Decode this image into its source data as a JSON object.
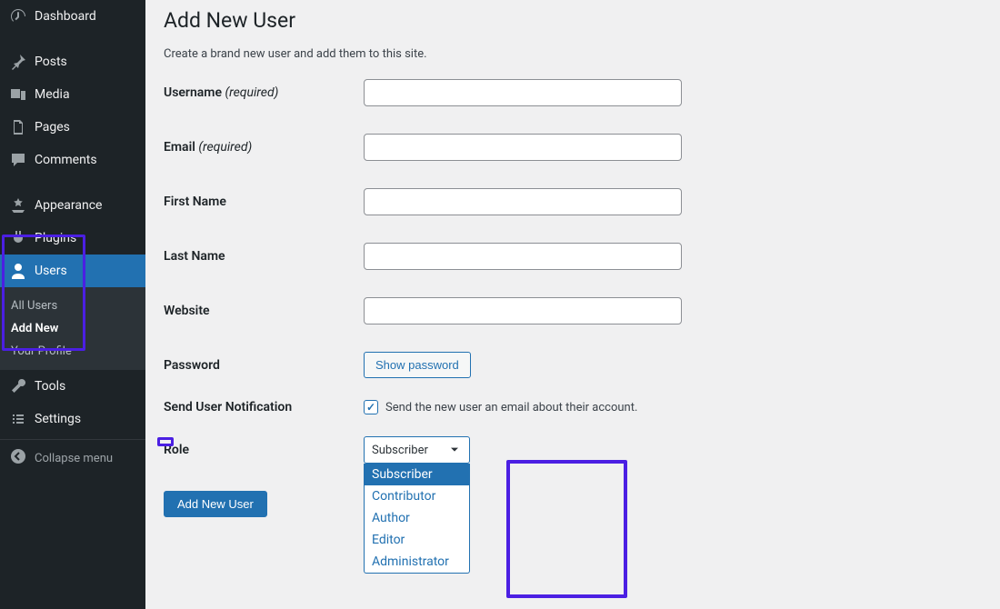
{
  "sidebar": {
    "items": [
      {
        "label": "Dashboard",
        "icon": "dashboard"
      },
      {
        "label": "Posts",
        "icon": "pin"
      },
      {
        "label": "Media",
        "icon": "media"
      },
      {
        "label": "Pages",
        "icon": "pages"
      },
      {
        "label": "Comments",
        "icon": "comments"
      },
      {
        "label": "Appearance",
        "icon": "appearance"
      },
      {
        "label": "Plugins",
        "icon": "plugins"
      },
      {
        "label": "Users",
        "icon": "users",
        "active": true
      },
      {
        "label": "Tools",
        "icon": "tools"
      },
      {
        "label": "Settings",
        "icon": "settings"
      }
    ],
    "submenu": {
      "items": [
        {
          "label": "All Users"
        },
        {
          "label": "Add New",
          "current": true
        },
        {
          "label": "Your Profile"
        }
      ]
    },
    "collapse_label": "Collapse menu"
  },
  "page": {
    "title": "Add New User",
    "description": "Create a brand new user and add them to this site."
  },
  "form": {
    "username_label": "Username",
    "required_text": "(required)",
    "email_label": "Email",
    "firstname_label": "First Name",
    "lastname_label": "Last Name",
    "website_label": "Website",
    "password_label": "Password",
    "show_password_btn": "Show password",
    "notify_label": "Send User Notification",
    "notify_checkbox_label": "Send the new user an email about their account.",
    "notify_checked": true,
    "role_label": "Role",
    "role_selected": "Subscriber",
    "role_options": [
      "Subscriber",
      "Contributor",
      "Author",
      "Editor",
      "Administrator"
    ],
    "submit_label": "Add New User"
  },
  "annotations": {
    "highlight_color": "#4b1fe3"
  }
}
